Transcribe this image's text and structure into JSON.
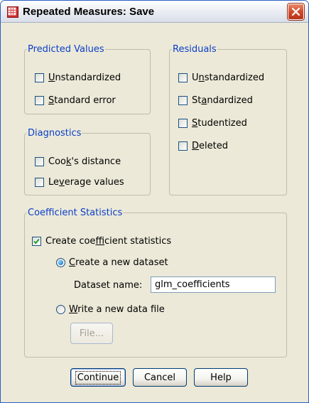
{
  "window": {
    "title": "Repeated Measures: Save"
  },
  "predicted_values": {
    "legend": "Predicted Values",
    "items": [
      {
        "label": "Unstandardized",
        "mnemonic": "U",
        "rest": "nstandardized",
        "checked": false
      },
      {
        "label": "Standard error",
        "mnemonic": "S",
        "rest": "tandard error",
        "checked": false
      }
    ]
  },
  "diagnostics": {
    "legend": "Diagnostics",
    "items": [
      {
        "label": "Cook's distance",
        "pre": "Coo",
        "mnemonic": "k",
        "rest": "'s distance",
        "checked": false
      },
      {
        "label": "Leverage values",
        "pre": "Le",
        "mnemonic": "v",
        "rest": "erage values",
        "checked": false
      }
    ]
  },
  "residuals": {
    "legend": "Residuals",
    "items": [
      {
        "label": "Unstandardized",
        "pre": "U",
        "mnemonic": "n",
        "rest": "standardized",
        "checked": false
      },
      {
        "label": "Standardized",
        "pre": "St",
        "mnemonic": "a",
        "rest": "ndardized",
        "checked": false
      },
      {
        "label": "Studentized",
        "pre": "",
        "mnemonic": "S",
        "rest": "tudentized",
        "checked": false
      },
      {
        "label": "Deleted",
        "pre": "",
        "mnemonic": "D",
        "rest": "eleted",
        "checked": false
      }
    ]
  },
  "coefficient_statistics": {
    "legend": "Coefficient Statistics",
    "create_checkbox": {
      "label": "Create coefficient statistics",
      "pre": "Create coe",
      "mnemonic": "f",
      "rest": "ficient statistics",
      "checked": true
    },
    "option_new_dataset": {
      "label": "Create a new dataset",
      "pre": "",
      "mnemonic": "C",
      "rest": "reate a new dataset",
      "selected": true
    },
    "dataset_name": {
      "label": "Dataset name:",
      "value": "glm_coefficients"
    },
    "option_data_file": {
      "label": "Write a new data file",
      "pre": "",
      "mnemonic": "W",
      "rest": "rite a new data file",
      "selected": false
    },
    "file_button": "File..."
  },
  "buttons": {
    "continue": "Continue",
    "cancel": "Cancel",
    "help": "Help"
  },
  "colors": {
    "group_legend": "#0a3ec8",
    "dialog_background": "#ece9d8",
    "close_button": "#cf4a2b"
  },
  "icons": {
    "app": "data-grid-icon",
    "close": "close-icon",
    "check": "checkmark-icon"
  }
}
